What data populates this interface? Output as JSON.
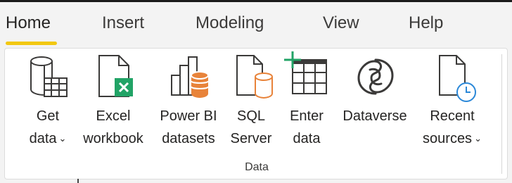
{
  "tabs": [
    {
      "label": "Home",
      "active": true
    },
    {
      "label": "Insert",
      "active": false
    },
    {
      "label": "Modeling",
      "active": false
    },
    {
      "label": "View",
      "active": false
    },
    {
      "label": "Help",
      "active": false
    }
  ],
  "ribbon": {
    "group_label": "Data",
    "buttons": [
      {
        "icon": "get-data-icon",
        "line1": "Get",
        "line2": "data",
        "dropdown": true
      },
      {
        "icon": "excel-icon",
        "line1": "Excel",
        "line2": "workbook",
        "dropdown": false
      },
      {
        "icon": "power-bi-datasets-icon",
        "line1": "Power BI",
        "line2": "datasets",
        "dropdown": false
      },
      {
        "icon": "sql-server-icon",
        "line1": "SQL",
        "line2": "Server",
        "dropdown": false
      },
      {
        "icon": "enter-data-icon",
        "line1": "Enter",
        "line2": "data",
        "dropdown": false
      },
      {
        "icon": "dataverse-icon",
        "line1": "Dataverse",
        "line2": "",
        "dropdown": false
      },
      {
        "icon": "recent-sources-icon",
        "line1": "Recent",
        "line2": "sources",
        "dropdown": true
      }
    ],
    "chevron": "⌄"
  },
  "colors": {
    "accent": "#f2c811",
    "excel_green": "#21a366",
    "data_orange": "#e8833a",
    "clock_blue": "#2b88d8"
  }
}
